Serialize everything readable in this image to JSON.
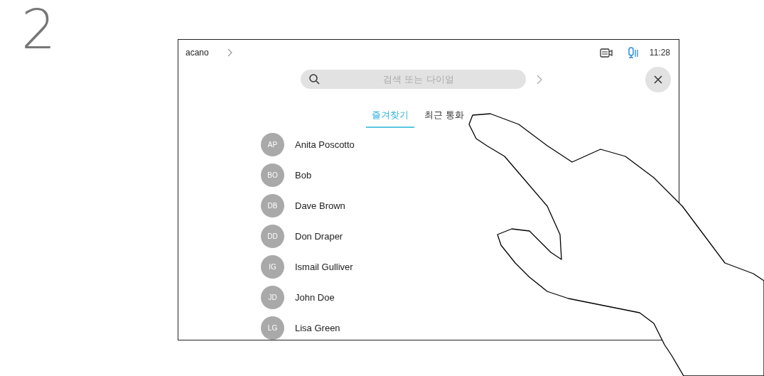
{
  "step_number": "2",
  "status_bar": {
    "device": "acano",
    "time": "11:28"
  },
  "search": {
    "placeholder": "검색 또는 다이얼"
  },
  "tabs": [
    {
      "label": "즐겨찾기",
      "selected": true
    },
    {
      "label": "최근 통화",
      "selected": false
    }
  ],
  "contacts": [
    {
      "initials": "AP",
      "name": "Anita Poscotto"
    },
    {
      "initials": "BO",
      "name": "Bob"
    },
    {
      "initials": "DB",
      "name": "Dave Brown"
    },
    {
      "initials": "DD",
      "name": "Don Draper"
    },
    {
      "initials": "IG",
      "name": "Ismail Gulliver"
    },
    {
      "initials": "JD",
      "name": "John Doe"
    },
    {
      "initials": "LG",
      "name": "Lisa Green"
    }
  ]
}
